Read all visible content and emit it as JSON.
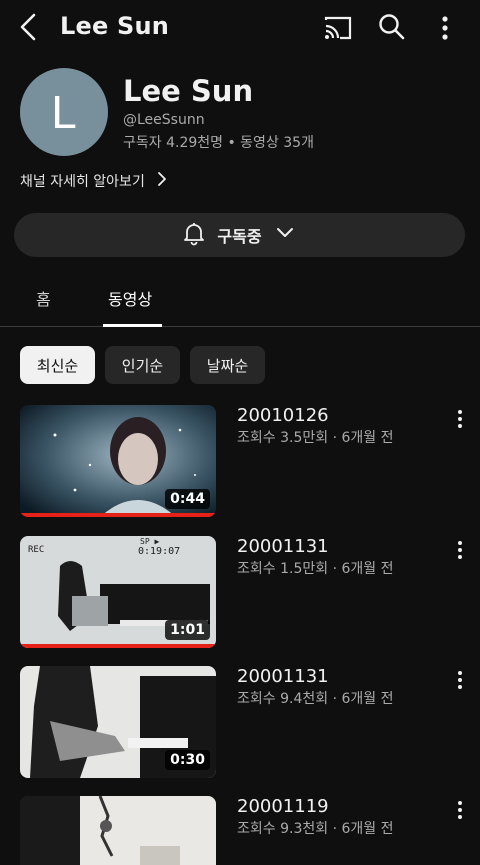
{
  "header": {
    "title": "Lee Sun",
    "back_icon": "back-arrow-icon",
    "cast_icon": "cast-icon",
    "search_icon": "search-icon",
    "more_icon": "more-vert-icon"
  },
  "channel": {
    "avatar_letter": "L",
    "avatar_color": "#78909c",
    "name": "Lee Sun",
    "handle": "@LeeSsunn",
    "stats": "구독자 4.29천명 • 동영상 35개",
    "more_info": "채널 자세히 알아보기"
  },
  "subscribe": {
    "label": "구독중",
    "bell_icon": "bell-icon",
    "chevron_icon": "chevron-down-icon"
  },
  "tabs": [
    {
      "label": "홈",
      "active": false
    },
    {
      "label": "동영상",
      "active": true
    }
  ],
  "filters": [
    {
      "label": "최신순",
      "active": true
    },
    {
      "label": "인기순",
      "active": false
    },
    {
      "label": "날짜순",
      "active": false
    }
  ],
  "videos": [
    {
      "title": "20010126",
      "meta": "조회수 3.5만회 · 6개월 전",
      "duration": "0:44",
      "watched": 1.0
    },
    {
      "title": "20001131",
      "meta": "조회수 1.5만회 · 6개월 전",
      "duration": "1:01",
      "watched": 1.0
    },
    {
      "title": "20001131",
      "meta": "조회수 9.4천회 · 6개월 전",
      "duration": "0:30",
      "watched": 0
    },
    {
      "title": "20001119",
      "meta": "조회수 9.3천회 · 6개월 전",
      "duration": "",
      "watched": 0
    }
  ],
  "thumb_text": {
    "rec": "REC",
    "sp": "SP ▶",
    "time": "0:19:07"
  },
  "colors": {
    "background": "#0f0f0f",
    "progress": "#e62117"
  }
}
